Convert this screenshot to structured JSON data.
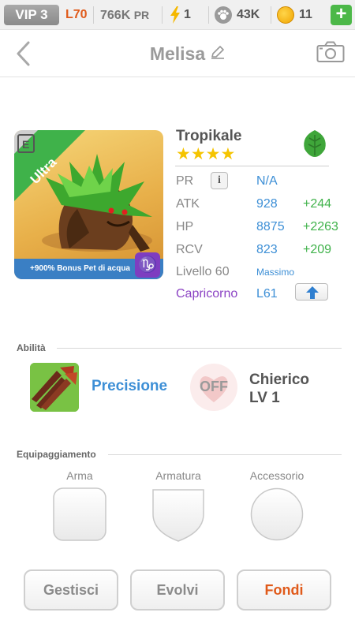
{
  "topbar": {
    "vip": "VIP 3",
    "level": "L70",
    "pr": "766K",
    "pr_unit": "PR",
    "energy": "1",
    "paws": "43K",
    "coins": "11",
    "plus": "+"
  },
  "header": {
    "title": "Melisa"
  },
  "pet": {
    "name": "Tropikale",
    "stars": "★★★★",
    "card_badge": "Ultra",
    "bonus_text": "+900% Bonus Pet di acqua",
    "stats": {
      "pr_label": "PR",
      "pr_value": "N/A",
      "atk_label": "ATK",
      "atk_value": "928",
      "atk_bonus": "+244",
      "hp_label": "HP",
      "hp_value": "8875",
      "hp_bonus": "+2263",
      "rcv_label": "RCV",
      "rcv_value": "823",
      "rcv_bonus": "+209",
      "level_label": "Livello 60",
      "level_note": "Massimo",
      "zodiac_label": "Capricorno",
      "zodiac_value": "L61"
    }
  },
  "skills": {
    "title": "Abilità",
    "active_name": "Precisione",
    "leader_state": "OFF",
    "leader_name": "Chierico",
    "leader_level": "LV 1"
  },
  "equipment": {
    "title": "Equipaggiamento",
    "weapon": "Arma",
    "armor": "Armatura",
    "accessory": "Accessorio"
  },
  "actions": {
    "manage": "Gestisci",
    "evolve": "Evolvi",
    "merge": "Fondi"
  },
  "colors": {
    "accent_blue": "#3d8fd6",
    "bonus_green": "#3fb24a",
    "orange": "#e05a1a",
    "zodiac_purple": "#8c44c4"
  }
}
